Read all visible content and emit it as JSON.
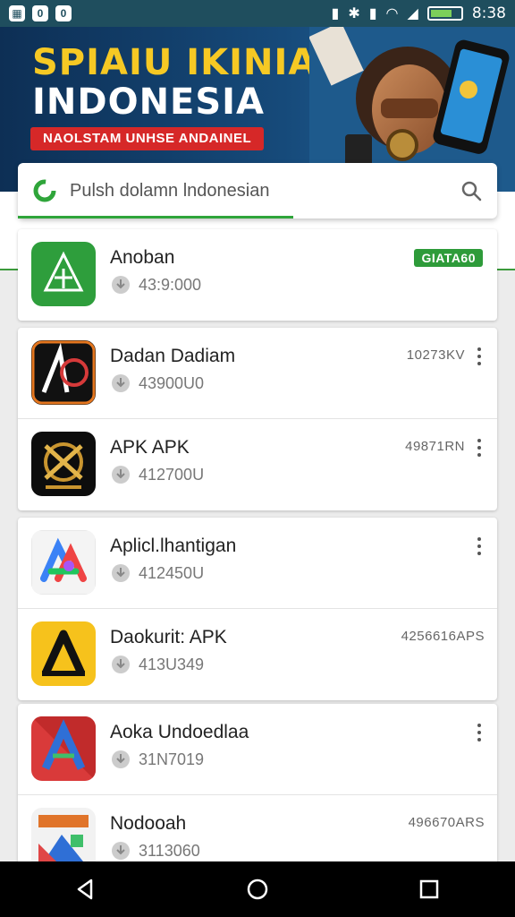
{
  "status_bar": {
    "left_icons": [
      "0",
      "0"
    ],
    "time": "8:38"
  },
  "banner": {
    "title_line1": "SPIAIU IKINIAM",
    "title_line2": "INDONESIA",
    "tagline": "NAOLSTAM UNHSE ANDAINEL",
    "colors": {
      "bg": "#164a7a",
      "title": "#f6c924",
      "tag": "#d62828"
    }
  },
  "search": {
    "placeholder": "Pulsh dolamn lndonesian",
    "icon": "search-icon"
  },
  "apps": [
    {
      "name": "Anoban",
      "count": "43:9:000",
      "badge": "GIATA60",
      "meta": ""
    },
    {
      "name": "Dadan Dadiam",
      "count": "43900U0",
      "meta": "10273KV"
    },
    {
      "name": "APK APK",
      "count": "412700U",
      "meta": "49871RN"
    },
    {
      "name": "Aplicl.lhantigan",
      "count": "412450U",
      "meta": ""
    },
    {
      "name": "Daokurit: APK",
      "count": "413U349",
      "meta": "4256616APS"
    },
    {
      "name": "Aoka Undoedlaa",
      "count": "31N7019",
      "meta": ""
    },
    {
      "name": "Nodooah",
      "count": "3113060",
      "meta": "496670ARS"
    }
  ],
  "nav": {
    "back": "back-icon",
    "home": "home-icon",
    "recent": "recent-apps-icon"
  }
}
